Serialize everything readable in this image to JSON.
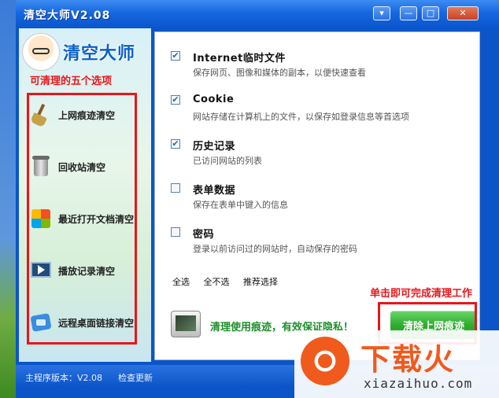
{
  "window": {
    "title": "清空大师V2.08",
    "controls": {
      "menu": "▾",
      "minimize": "—",
      "maximize": "□",
      "close": "✕"
    }
  },
  "sidebar": {
    "logo_text": "清空大师",
    "caption": "可清理的五个选项",
    "items": [
      {
        "label": "上网痕迹清空",
        "icon": "broom-icon"
      },
      {
        "label": "回收站清空",
        "icon": "recycle-bin-icon"
      },
      {
        "label": "最近打开文档清空",
        "icon": "recent-docs-icon"
      },
      {
        "label": "播放记录清空",
        "icon": "media-player-icon"
      },
      {
        "label": "远程桌面链接清空",
        "icon": "remote-desktop-icon"
      }
    ]
  },
  "options": [
    {
      "title": "Internet临时文件",
      "desc": "保存网页、图像和媒体的副本，以便快速查看",
      "checked": true
    },
    {
      "title": "Cookie",
      "desc": "网站存储在计算机上的文件，以保存如登录信息等首选项",
      "checked": true
    },
    {
      "title": "历史记录",
      "desc": "已访问网站的列表",
      "checked": true
    },
    {
      "title": "表单数据",
      "desc": "保存在表单中键入的信息",
      "checked": false
    },
    {
      "title": "密码",
      "desc": "登录以前访问过的网站时，自动保存的密码",
      "checked": false
    }
  ],
  "selection": {
    "all": "全选",
    "none": "全不选",
    "recommended": "推荐选择"
  },
  "bottom": {
    "slogan": "清理使用痕迹，有效保证隐私！",
    "clean_button": "清除上网痕迹",
    "click_caption": "单击即可完成清理工作"
  },
  "status": {
    "version": "主程序版本：V2.08",
    "check_update": "检查更新"
  },
  "watermark": {
    "brand": "下载火",
    "url": "xiazaihuo.com"
  },
  "colors": {
    "accent": "#0b55c9",
    "annotation_red": "#e8161b",
    "slogan_green": "#1d8f2a",
    "button_green": "#2fae2f"
  }
}
